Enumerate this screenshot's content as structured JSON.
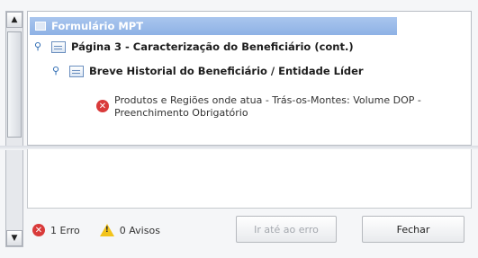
{
  "tree": {
    "root_label": "Formulário MPT",
    "page_label": "Página 3 - Caracterização do Beneficiário (cont.)",
    "section_label": "Breve Historial do Beneficiário / Entidade Líder",
    "error_line1": "Produtos e Regiões onde atua - Trás-os-Montes: Volume DOP -",
    "error_line2": "Preenchimento Obrigatório"
  },
  "footer": {
    "errors_label": "1 Erro",
    "warnings_label": "0 Avisos",
    "goto_button": "Ir até ao erro",
    "close_button": "Fechar"
  },
  "icons": {
    "error": "error-icon",
    "warning": "warning-icon",
    "pin": "pin-icon",
    "page": "page-icon",
    "form": "form-icon"
  },
  "colors": {
    "selection": "#8eb2e5",
    "error": "#d93a3a",
    "warning": "#f2c31a"
  }
}
